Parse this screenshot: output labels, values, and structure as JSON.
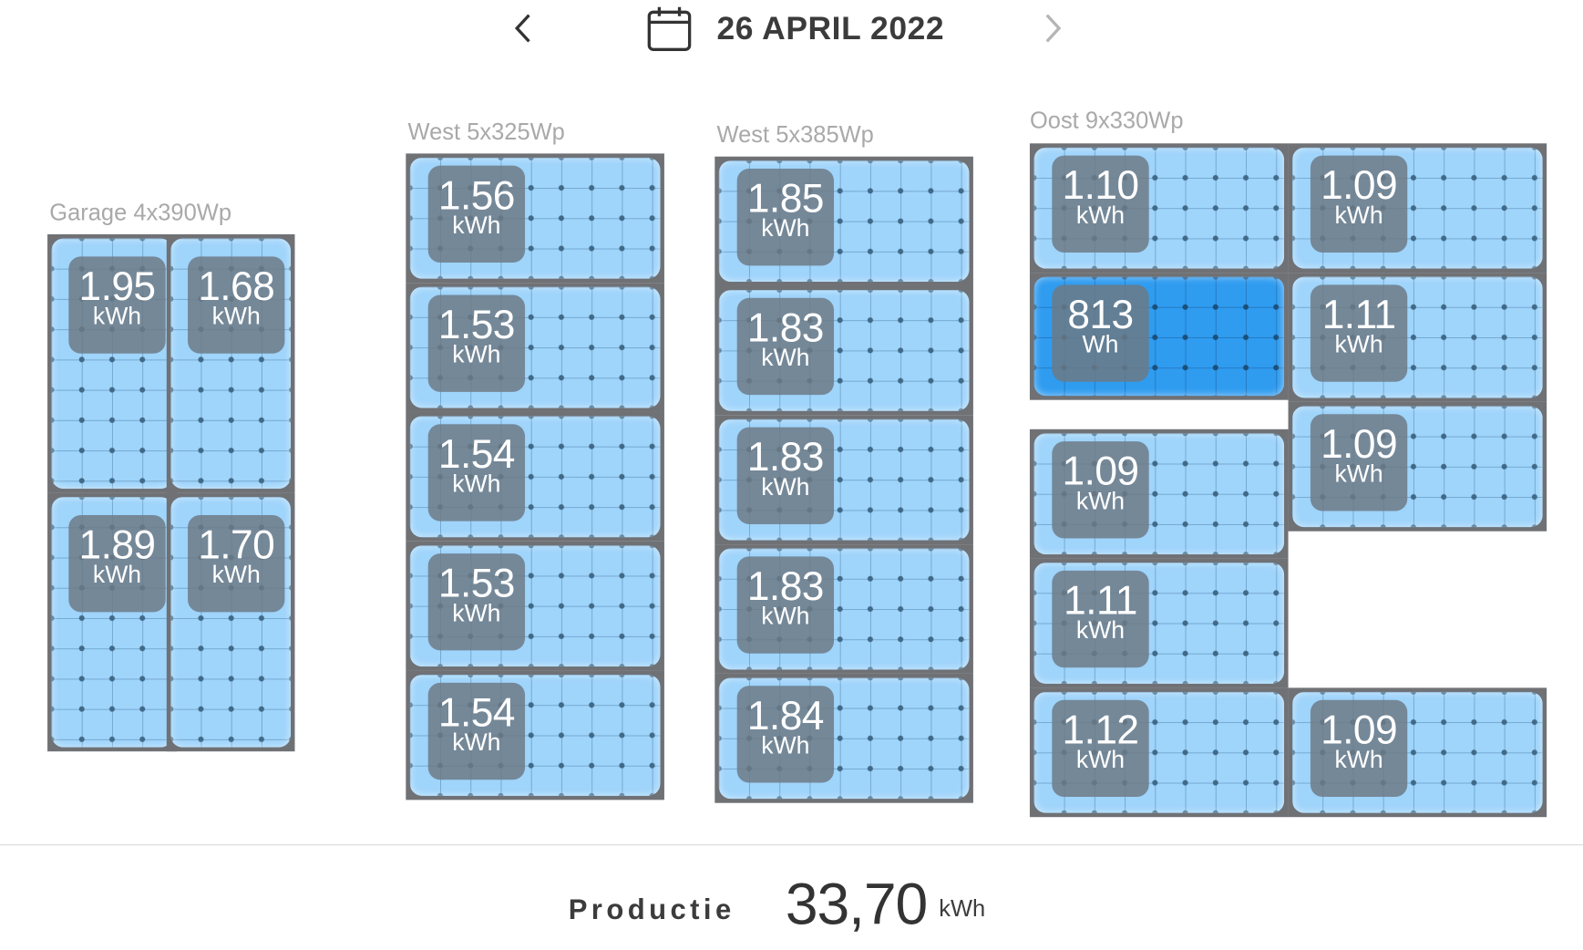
{
  "header": {
    "date": "26 APRIL 2022",
    "prev_icon": "chevron-left-icon",
    "next_icon": "chevron-right-icon",
    "calendar_icon": "calendar-icon"
  },
  "groups": {
    "garage": {
      "label": "Garage 4x390Wp",
      "panels": [
        {
          "value": "1.95",
          "unit": "kWh"
        },
        {
          "value": "1.68",
          "unit": "kWh"
        },
        {
          "value": "1.89",
          "unit": "kWh"
        },
        {
          "value": "1.70",
          "unit": "kWh"
        }
      ]
    },
    "west325": {
      "label": "West 5x325Wp",
      "panels": [
        {
          "value": "1.56",
          "unit": "kWh"
        },
        {
          "value": "1.53",
          "unit": "kWh"
        },
        {
          "value": "1.54",
          "unit": "kWh"
        },
        {
          "value": "1.53",
          "unit": "kWh"
        },
        {
          "value": "1.54",
          "unit": "kWh"
        }
      ]
    },
    "west385": {
      "label": "West 5x385Wp",
      "panels": [
        {
          "value": "1.85",
          "unit": "kWh"
        },
        {
          "value": "1.83",
          "unit": "kWh"
        },
        {
          "value": "1.83",
          "unit": "kWh"
        },
        {
          "value": "1.83",
          "unit": "kWh"
        },
        {
          "value": "1.84",
          "unit": "kWh"
        }
      ]
    },
    "oost": {
      "label": "Oost 9x330Wp",
      "panels": [
        {
          "value": "1.10",
          "unit": "kWh"
        },
        {
          "value": "1.09",
          "unit": "kWh"
        },
        {
          "value": "813",
          "unit": "Wh"
        },
        {
          "value": "1.11",
          "unit": "kWh"
        },
        {
          "value": "1.09",
          "unit": "kWh"
        },
        {
          "value": "1.09",
          "unit": "kWh"
        },
        {
          "value": "1.11",
          "unit": "kWh"
        },
        {
          "value": "1.12",
          "unit": "kWh"
        },
        {
          "value": "1.09",
          "unit": "kWh"
        }
      ]
    }
  },
  "colors": {
    "panel": "#9fd4fb",
    "panel_highlight": "#2f9cf0",
    "frame": "#6f7175",
    "label": "#a9a9a9"
  },
  "footer": {
    "label": "Productie",
    "value": "33,70",
    "unit": "kWh"
  }
}
